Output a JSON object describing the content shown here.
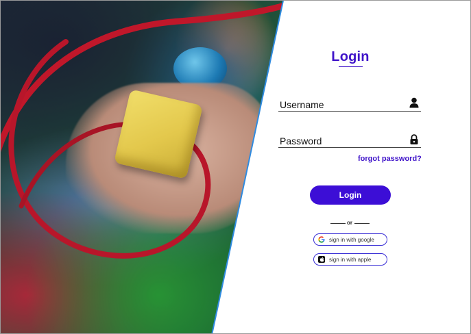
{
  "login": {
    "title": "Login",
    "username_label": "Username",
    "password_label": "Password",
    "forgot_password": "forgot password?",
    "login_button": "Login",
    "divider_text": "or",
    "google_button": "sign in with google",
    "apple_button": "sign in with apple"
  },
  "icons": {
    "username": "user-icon",
    "password": "lock-icon",
    "google": "google-icon",
    "apple": "apple-icon"
  },
  "colors": {
    "accent": "#3f13c9",
    "button": "#3c0ed6",
    "edge": "#2f8be0"
  }
}
